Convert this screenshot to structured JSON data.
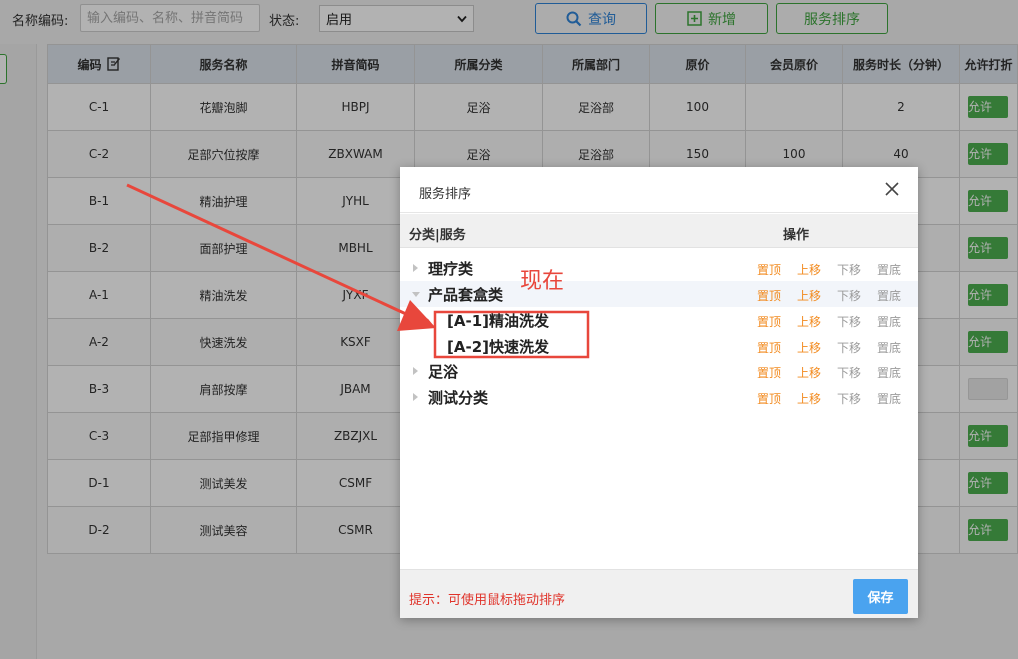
{
  "toolbar": {
    "name_code_label": "名称编码:",
    "search_placeholder": "输入编码、名称、拼音简码",
    "status_label": "状态:",
    "status_selected": "启用",
    "query_label": "查询",
    "add_label": "新增",
    "sort_label": "服务排序"
  },
  "table": {
    "headers": [
      "编码",
      "服务名称",
      "拼音简码",
      "所属分类",
      "所属部门",
      "原价",
      "会员原价",
      "服务时长（分钟）",
      "允许打折"
    ],
    "allow_label": "允许",
    "rows": [
      {
        "code": "C-1",
        "name": "花瓣泡脚",
        "pinyin": "HBPJ",
        "category": "足浴",
        "dept": "足浴部",
        "price": "100",
        "member_price": "",
        "duration": "2",
        "allow": true
      },
      {
        "code": "C-2",
        "name": "足部穴位按摩",
        "pinyin": "ZBXWAM",
        "category": "足浴",
        "dept": "足浴部",
        "price": "150",
        "member_price": "100",
        "duration": "40",
        "allow": true
      },
      {
        "code": "B-1",
        "name": "精油护理",
        "pinyin": "JYHL",
        "category": "",
        "dept": "",
        "price": "",
        "member_price": "",
        "duration": "",
        "allow": true
      },
      {
        "code": "B-2",
        "name": "面部护理",
        "pinyin": "MBHL",
        "category": "",
        "dept": "",
        "price": "",
        "member_price": "",
        "duration": "",
        "allow": true
      },
      {
        "code": "A-1",
        "name": "精油洗发",
        "pinyin": "JYXF",
        "category": "",
        "dept": "",
        "price": "",
        "member_price": "",
        "duration": "",
        "allow": true
      },
      {
        "code": "A-2",
        "name": "快速洗发",
        "pinyin": "KSXF",
        "category": "",
        "dept": "",
        "price": "",
        "member_price": "",
        "duration": "",
        "allow": true
      },
      {
        "code": "B-3",
        "name": "肩部按摩",
        "pinyin": "JBAM",
        "category": "",
        "dept": "",
        "price": "",
        "member_price": "",
        "duration": "",
        "allow": false
      },
      {
        "code": "C-3",
        "name": "足部指甲修理",
        "pinyin": "ZBZJXL",
        "category": "",
        "dept": "",
        "price": "",
        "member_price": "",
        "duration": "",
        "allow": true
      },
      {
        "code": "D-1",
        "name": "测试美发",
        "pinyin": "CSMF",
        "category": "",
        "dept": "",
        "price": "",
        "member_price": "",
        "duration": "",
        "allow": true
      },
      {
        "code": "D-2",
        "name": "测试美容",
        "pinyin": "CSMR",
        "category": "",
        "dept": "",
        "price": "",
        "member_price": "",
        "duration": "",
        "allow": true
      }
    ]
  },
  "dialog": {
    "title": "服务排序",
    "col_category": "分类|服务",
    "col_ops": "操作",
    "ops": {
      "top": "置顶",
      "up": "上移",
      "down": "下移",
      "bottom": "置底"
    },
    "tree": [
      {
        "label": "理疗类",
        "kind": "cat",
        "expanded": false
      },
      {
        "label": "产品套盒类",
        "kind": "cat",
        "expanded": true
      },
      {
        "label": "[A-1]精油洗发",
        "kind": "svc"
      },
      {
        "label": "[A-2]快速洗发",
        "kind": "svc"
      },
      {
        "label": "足浴",
        "kind": "cat",
        "expanded": false
      },
      {
        "label": "测试分类",
        "kind": "cat",
        "expanded": false
      }
    ],
    "tip": "提示：可使用鼠标拖动排序",
    "save_label": "保存"
  },
  "annotation": {
    "text": "现在",
    "color": "#e8473c"
  },
  "colors": {
    "primary_blue": "#2f84d8",
    "success_green": "#4caf50",
    "orange_op": "#f28a1e",
    "save_blue": "#4aa3ef",
    "tip_red": "#e0332a"
  }
}
